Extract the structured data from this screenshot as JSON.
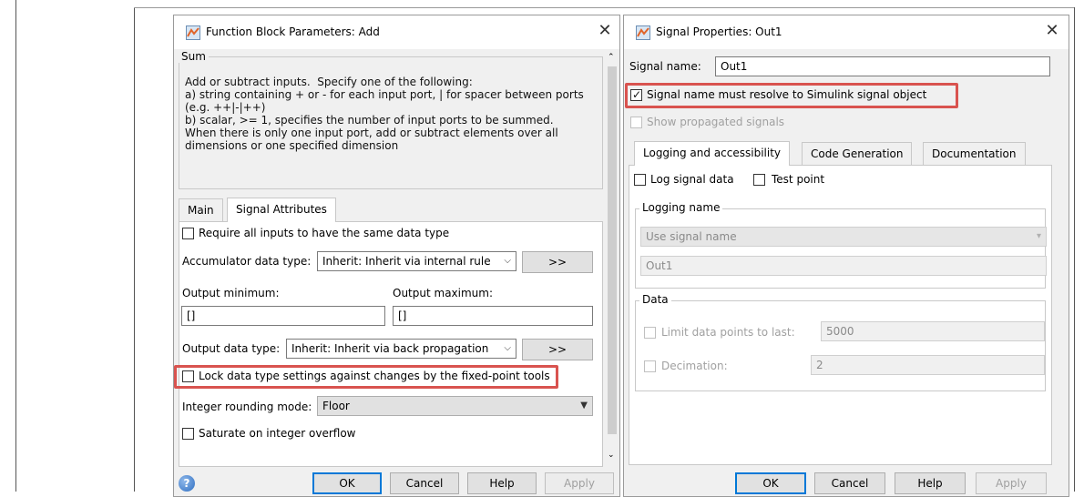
{
  "function_dialog": {
    "title": "Function Block Parameters: Add",
    "close_glyph": "✕",
    "group_title": "Sum",
    "description": "Add or subtract inputs.  Specify one of the following:\na) string containing + or - for each input port, | for spacer between ports\n(e.g. ++|-|++)\nb) scalar, >= 1, specifies the number of input ports to be summed.\nWhen there is only one input port, add or subtract elements over all\ndimensions or one specified dimension",
    "tabs": [
      {
        "label": "Main",
        "active": false
      },
      {
        "label": "Signal Attributes",
        "active": true
      }
    ],
    "require_same_type": {
      "label": "Require all inputs to have the same data type",
      "checked": false
    },
    "accumulator": {
      "label": "Accumulator data type:",
      "value": "Inherit: Inherit via internal rule",
      "assist_label": ">>"
    },
    "output_min": {
      "label": "Output minimum:",
      "value": "[]"
    },
    "output_max": {
      "label": "Output maximum:",
      "value": "[]"
    },
    "output_type": {
      "label": "Output data type:",
      "value": "Inherit: Inherit via back propagation",
      "assist_label": ">>"
    },
    "lock_settings": {
      "label": "Lock data type settings against changes by the fixed-point tools",
      "checked": false
    },
    "rounding": {
      "label": "Integer rounding mode:",
      "value": "Floor"
    },
    "saturate": {
      "label": "Saturate on integer overflow",
      "checked": false
    },
    "buttons": {
      "ok": "OK",
      "cancel": "Cancel",
      "help": "Help",
      "apply": "Apply"
    },
    "help_glyph": "?"
  },
  "signal_dialog": {
    "title": "Signal Properties: Out1",
    "close_glyph": "✕",
    "signal_name_label": "Signal name:",
    "signal_name_value": "Out1",
    "resolve": {
      "label": "Signal name must resolve to Simulink signal object",
      "checked": true
    },
    "show_propagated": {
      "label": "Show propagated signals",
      "checked": false
    },
    "tabs": [
      {
        "label": "Logging and accessibility",
        "active": true
      },
      {
        "label": "Code Generation",
        "active": false
      },
      {
        "label": "Documentation",
        "active": false
      }
    ],
    "log_signal": {
      "label": "Log signal data",
      "checked": false
    },
    "test_point": {
      "label": "Test point",
      "checked": false
    },
    "logging_group": "Logging name",
    "logging_mode": "Use signal name",
    "logging_value": "Out1",
    "data_group": "Data",
    "limit_points": {
      "label": "Limit data points to last:",
      "value": "5000",
      "checked": false
    },
    "decimation": {
      "label": "Decimation:",
      "value": "2",
      "checked": false
    },
    "buttons": {
      "ok": "OK",
      "cancel": "Cancel",
      "help": "Help",
      "apply": "Apply"
    }
  },
  "colors": {
    "highlight": "#d9534f",
    "focus_blue": "#0078d7"
  },
  "check_glyph": "✓",
  "dropdown_glyph": "▾",
  "caret_glyph": "▼"
}
